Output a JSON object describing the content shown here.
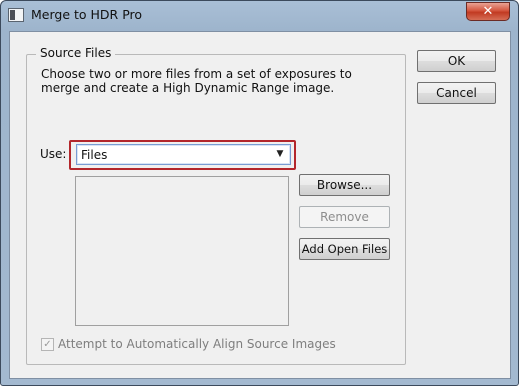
{
  "window": {
    "title": "Merge to HDR Pro",
    "close_glyph": "✕"
  },
  "source_files": {
    "group_label": "Source Files",
    "description_line1": "Choose two or more files from a set of exposures to",
    "description_line2": "merge and create a High Dynamic Range image.",
    "use_label": "Use:",
    "use_selected": "Files",
    "dropdown_glyph": "▼",
    "file_list": []
  },
  "buttons": {
    "browse": "Browse...",
    "remove": "Remove",
    "add_open_files": "Add Open Files",
    "ok": "OK",
    "cancel": "Cancel"
  },
  "align": {
    "label": "Attempt to Automatically Align Source Images",
    "checked": true,
    "check_glyph": "✓"
  },
  "colors": {
    "highlight": "#b3262b",
    "close_button": "#c13a22"
  }
}
